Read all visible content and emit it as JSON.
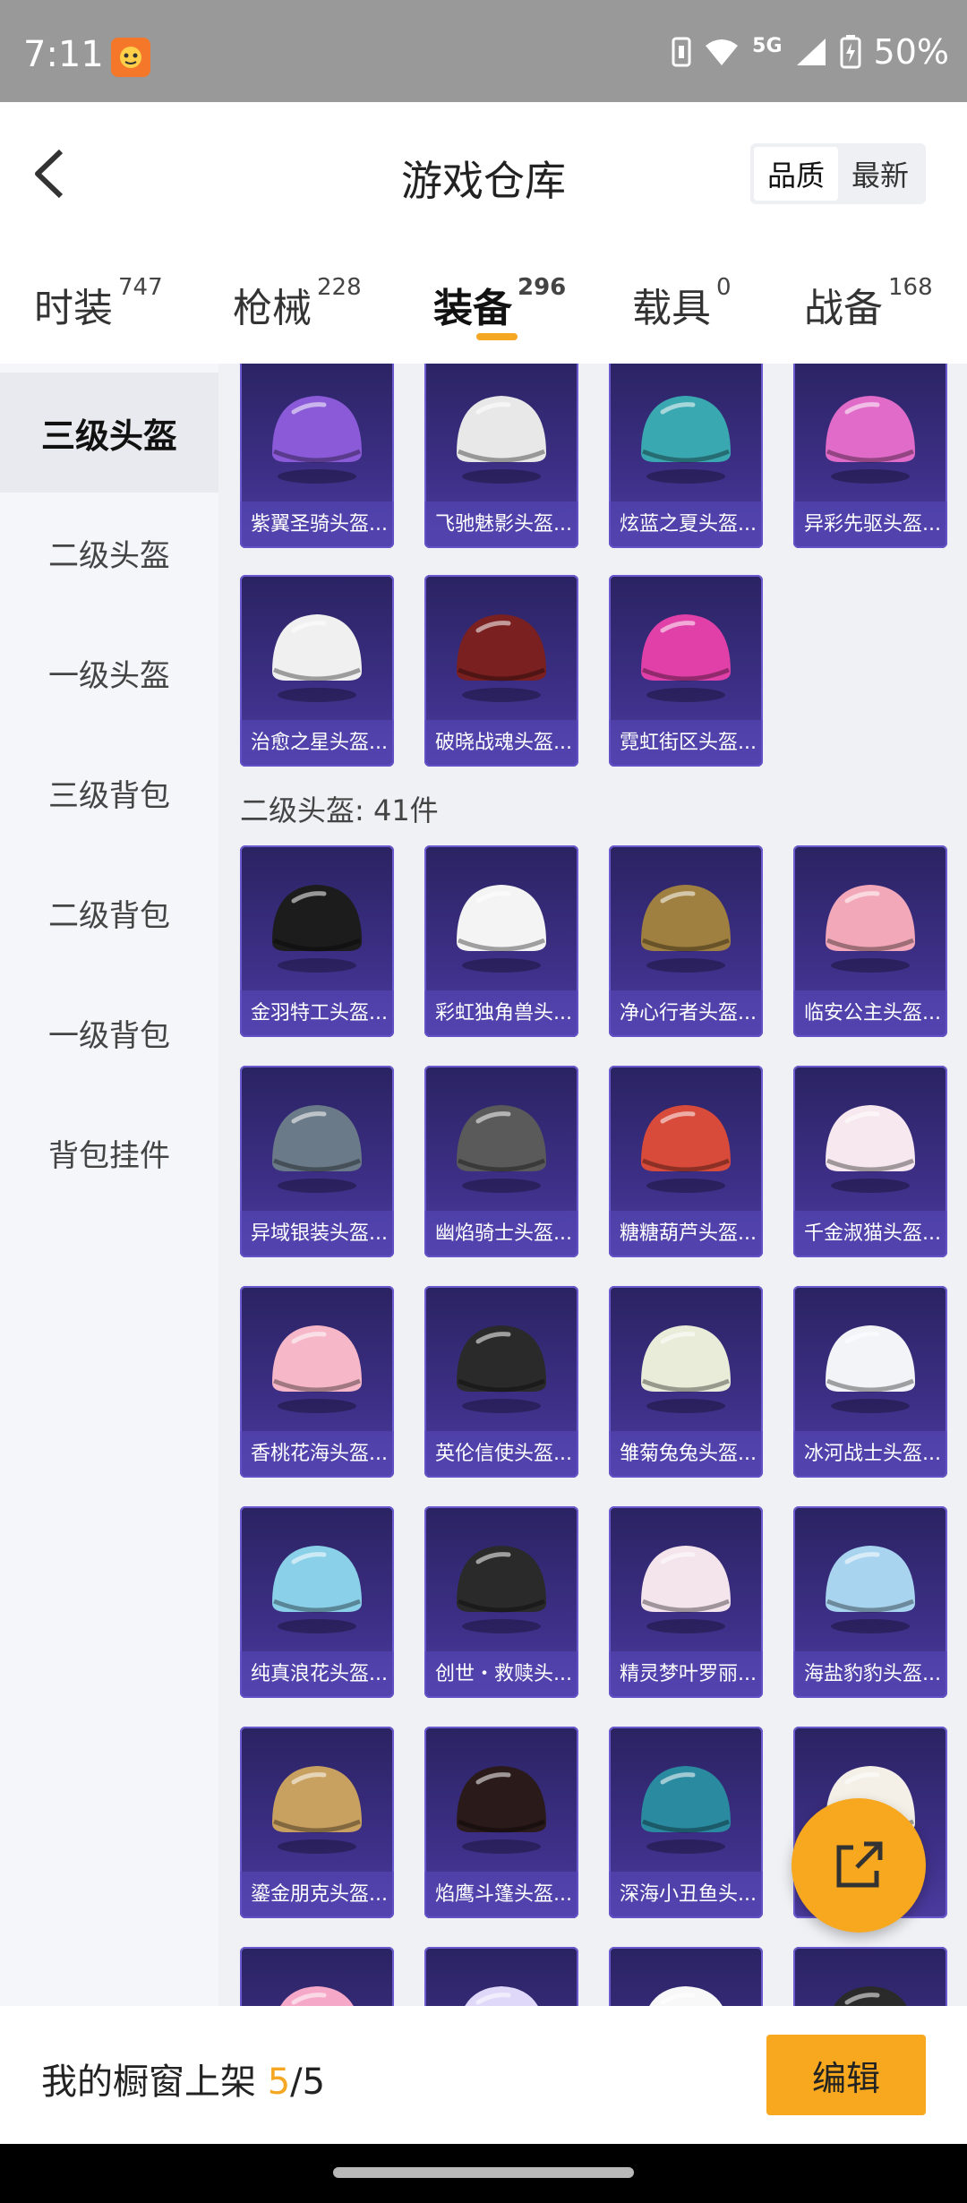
{
  "status": {
    "time": "7:11",
    "battery": "50%",
    "network": "5G"
  },
  "header": {
    "title": "游戏仓库",
    "sort_options": [
      "品质",
      "最新"
    ],
    "sort_active": 0
  },
  "tabs": [
    {
      "label": "时装",
      "count": "747"
    },
    {
      "label": "枪械",
      "count": "228"
    },
    {
      "label": "装备",
      "count": "296"
    },
    {
      "label": "载具",
      "count": "0"
    },
    {
      "label": "战备",
      "count": "168"
    }
  ],
  "sidebar": [
    "三级头盔",
    "二级头盔",
    "一级头盔",
    "三级背包",
    "二级背包",
    "一级背包",
    "背包挂件"
  ],
  "level3": [
    {
      "name": "紫翼圣骑头盔...",
      "icon": "helmet-icon",
      "color": "#8a5ad8"
    },
    {
      "name": "飞驰魅影头盔...",
      "icon": "helmet-icon",
      "color": "#e8e8e8"
    },
    {
      "name": "炫蓝之夏头盔...",
      "icon": "helmet-icon",
      "color": "#3aa8b0"
    },
    {
      "name": "异彩先驱头盔...",
      "icon": "helmet-icon",
      "color": "#e06bc8"
    },
    {
      "name": "治愈之星头盔...",
      "icon": "helmet-icon",
      "color": "#f0f0f0"
    },
    {
      "name": "破晓战魂头盔...",
      "icon": "helmet-icon",
      "color": "#7a2020"
    },
    {
      "name": "霓虹街区头盔...",
      "icon": "helmet-icon",
      "color": "#e040a8"
    }
  ],
  "level2": {
    "label": "二级头盔: 41件",
    "items": [
      {
        "name": "金羽特工头盔...",
        "icon": "helmet-icon",
        "color": "#1c1c1c"
      },
      {
        "name": "彩虹独角兽头...",
        "icon": "helmet-icon",
        "color": "#f4f4f4"
      },
      {
        "name": "净心行者头盔...",
        "icon": "helmet-icon",
        "color": "#a08040"
      },
      {
        "name": "临安公主头盔...",
        "icon": "helmet-icon",
        "color": "#f2a8b8"
      },
      {
        "name": "异域银装头盔...",
        "icon": "helmet-icon",
        "color": "#6a7a88"
      },
      {
        "name": "幽焰骑士头盔...",
        "icon": "helmet-icon",
        "color": "#5a5a5a"
      },
      {
        "name": "糖糖葫芦头盔...",
        "icon": "helmet-icon",
        "color": "#d84a3a"
      },
      {
        "name": "千金淑猫头盔...",
        "icon": "helmet-icon",
        "color": "#f6e8ee"
      },
      {
        "name": "香桃花海头盔...",
        "icon": "helmet-icon",
        "color": "#f6b8c8"
      },
      {
        "name": "英伦信使头盔...",
        "icon": "helmet-icon",
        "color": "#2a2a2a"
      },
      {
        "name": "雏菊兔兔头盔...",
        "icon": "helmet-icon",
        "color": "#e8ecd8"
      },
      {
        "name": "冰河战士头盔...",
        "icon": "helmet-icon",
        "color": "#f2f4f8"
      },
      {
        "name": "纯真浪花头盔...",
        "icon": "helmet-icon",
        "color": "#8ad0e8"
      },
      {
        "name": "创世・救赎头...",
        "icon": "helmet-icon",
        "color": "#2a2a2a"
      },
      {
        "name": "精灵梦叶罗丽...",
        "icon": "helmet-icon",
        "color": "#f4e4ec"
      },
      {
        "name": "海盐豹豹头盔...",
        "icon": "helmet-icon",
        "color": "#a8d4f0"
      },
      {
        "name": "鎏金朋克头盔...",
        "icon": "helmet-icon",
        "color": "#c8a060"
      },
      {
        "name": "焰鹰斗篷头盔...",
        "icon": "helmet-icon",
        "color": "#2a1a1a"
      },
      {
        "name": "深海小丑鱼头...",
        "icon": "helmet-icon",
        "color": "#2a8aa0"
      },
      {
        "name": "",
        "icon": "helmet-icon",
        "color": "#f4f0e8"
      },
      {
        "name": "",
        "icon": "helmet-icon",
        "color": "#f6a8c8"
      },
      {
        "name": "",
        "icon": "helmet-icon",
        "color": "#e0d8f8"
      },
      {
        "name": "",
        "icon": "helmet-icon",
        "color": "#f8f8f8"
      },
      {
        "name": "",
        "icon": "helmet-icon",
        "color": "#2a2a2a"
      }
    ]
  },
  "bottom": {
    "label": "我的橱窗上架",
    "current": "5",
    "total": "/5",
    "edit_label": "编辑"
  }
}
